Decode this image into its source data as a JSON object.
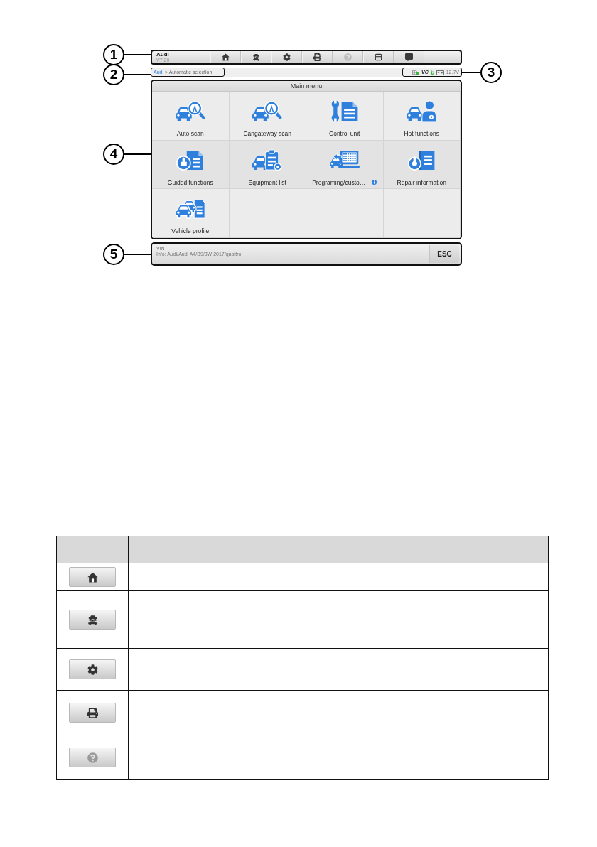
{
  "screen": {
    "toolbar": {
      "callout": "1",
      "title": "Audi",
      "version": "V7.20",
      "buttons": [
        {
          "kind": "home",
          "disabled": false
        },
        {
          "kind": "car_lift",
          "disabled": false
        },
        {
          "kind": "settings",
          "disabled": false
        },
        {
          "kind": "print",
          "disabled": false
        },
        {
          "kind": "help",
          "disabled": true
        },
        {
          "kind": "window",
          "disabled": false
        },
        {
          "kind": "chat",
          "disabled": false
        }
      ]
    },
    "info_bar": {
      "breadcrumb": {
        "callout": "2",
        "root": "Audi",
        "path": "> Automatic selection"
      },
      "status": {
        "callout": "3",
        "vci_label": "VC",
        "voltage": "12.7V"
      }
    },
    "main_menu": {
      "callout": "4",
      "title": "Main menu",
      "items": [
        {
          "kind": "auto_scan",
          "label": "Auto scan",
          "info": false
        },
        {
          "kind": "gateway_scan",
          "label": "Cangateway scan",
          "info": false
        },
        {
          "kind": "control_unit",
          "label": "Control unit",
          "info": false
        },
        {
          "kind": "hot_functions",
          "label": "Hot functions",
          "info": false
        },
        {
          "kind": "guided_functions",
          "label": "Guided functions",
          "info": false
        },
        {
          "kind": "equipment_list",
          "label": "Equipment list",
          "info": false
        },
        {
          "kind": "programming",
          "label": "Programing/custo…",
          "info": true
        },
        {
          "kind": "repair_information",
          "label": "Repair information",
          "info": false
        },
        {
          "kind": "vehicle_profile",
          "label": "Vehicle profile",
          "info": false
        }
      ]
    },
    "footer": {
      "callout": "5",
      "vin_label": "VIN",
      "vehicle_info": "Info: Audi/Audi A4/B9/8W 2017/quattro",
      "esc": "ESC"
    }
  },
  "table": {
    "rows": [
      {
        "kind": "home",
        "disabled": false
      },
      {
        "kind": "car_lift",
        "disabled": false
      },
      {
        "kind": "settings",
        "disabled": false
      },
      {
        "kind": "print",
        "disabled": false
      },
      {
        "kind": "help",
        "disabled": true
      }
    ]
  }
}
